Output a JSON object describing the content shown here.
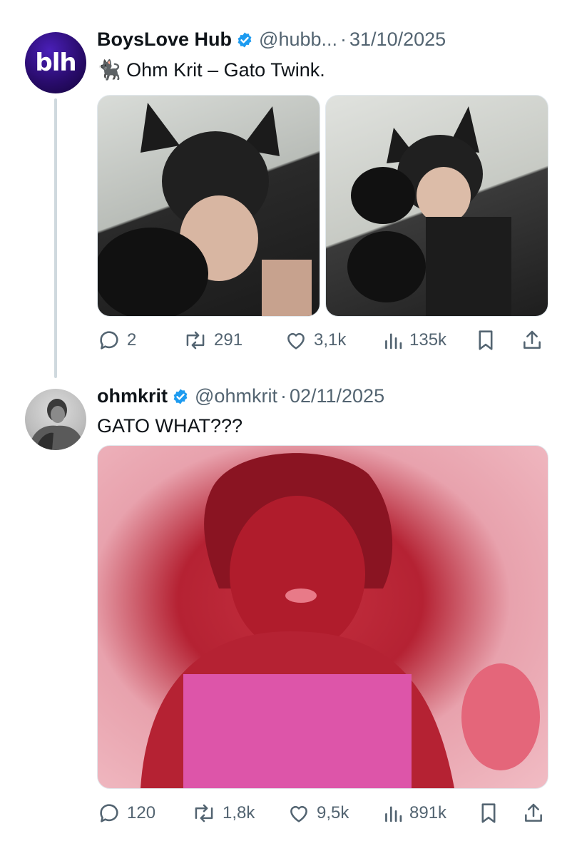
{
  "tweet1": {
    "name": "BoysLove Hub",
    "handle": "@hubb...",
    "separator": "·",
    "date": "31/10/2025",
    "text": "🐈‍⬛ Ohm Krit – Gato Twink.",
    "avatar_text": "blh",
    "stats": {
      "replies": "2",
      "reposts": "291",
      "likes": "3,1k",
      "views": "135k"
    }
  },
  "tweet2": {
    "name": "ohmkrit",
    "handle": "@ohmkrit",
    "separator": "·",
    "date": "02/11/2025",
    "text": "GATO WHAT???",
    "stats": {
      "replies": "120",
      "reposts": "1,8k",
      "likes": "9,5k",
      "views": "891k"
    }
  },
  "colors": {
    "verified": "#1d9bf0",
    "muted": "#536471",
    "thread_line": "#cfd9de",
    "avatar_bg": "#2a0c6e"
  },
  "icons": [
    "verified-badge-icon",
    "reply-icon",
    "repost-icon",
    "like-icon",
    "views-icon",
    "bookmark-icon",
    "share-icon"
  ]
}
